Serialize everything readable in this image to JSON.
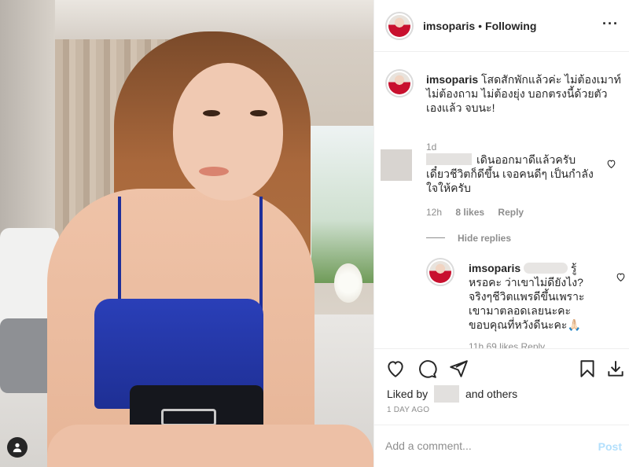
{
  "post": {
    "username": "imsoparis",
    "follow_separator": "•",
    "follow_status": "Following",
    "more_label": "···",
    "caption_text": " โสดสักพักแล้วค่ะ ไม่ต้องเมาท์ ไม่ต้องถาม ไม่ต้องยุ่ง บอกตรงนี้ด้วยตัวเองแล้ว จบนะ!",
    "caption_time": "1d"
  },
  "comments": [
    {
      "text": "เดินออกมาดีแล้วครับ เดี๋ยวชีวิตก็ดีขึ้น เจอคนดีๆ เป็นกำลังใจให้ครับ",
      "time": "12h",
      "likes": "8 likes",
      "reply_label": "Reply"
    }
  ],
  "hide_replies_label": "Hide replies",
  "reply": {
    "username": "imsoparis",
    "text": " รู้หรอคะ ว่าเขาไม่ดียังไง? จริงๆชีวิตแพรดีขึ้นเพราะเขามาตลอดเลยนะคะ ขอบคุณที่หวังดีนะคะ🙏🏻",
    "meta": "11h  69 likes  Reply"
  },
  "likes": {
    "prefix": "Liked by",
    "suffix": "and others"
  },
  "date_label": "1 DAY AGO",
  "add_comment": {
    "placeholder": "Add a comment...",
    "post_label": "Post"
  },
  "colors": {
    "link_disabled": "#b2dffc",
    "secondary_text": "#8e8e8e",
    "primary_text": "#262626"
  },
  "icons": [
    "heart-icon",
    "comment-icon",
    "share-icon",
    "bookmark-icon",
    "download-icon",
    "user-tag-icon"
  ]
}
